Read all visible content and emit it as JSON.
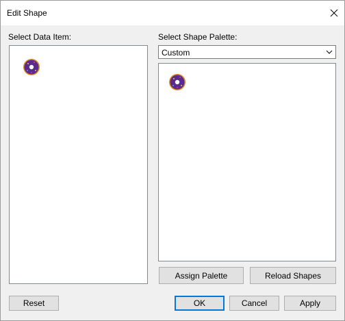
{
  "window": {
    "title": "Edit Shape",
    "close_icon": "close-icon"
  },
  "left_panel": {
    "label": "Select Data Item:",
    "items": [
      {
        "icon": "donut-shape-icon",
        "colors": {
          "ring": "#5a2a8c",
          "rim": "#e08a1e",
          "speckle": "#f2c14e"
        }
      }
    ]
  },
  "right_panel": {
    "label": "Select Shape Palette:",
    "palette_selected": "Custom",
    "shapes": [
      {
        "icon": "donut-shape-icon"
      }
    ],
    "assign_palette_label": "Assign Palette",
    "reload_shapes_label": "Reload Shapes"
  },
  "footer": {
    "reset_label": "Reset",
    "ok_label": "OK",
    "cancel_label": "Cancel",
    "apply_label": "Apply"
  },
  "colors": {
    "dialog_bg": "#f0f0f0",
    "button_bg": "#e1e1e1",
    "focus_border": "#0078d7"
  }
}
